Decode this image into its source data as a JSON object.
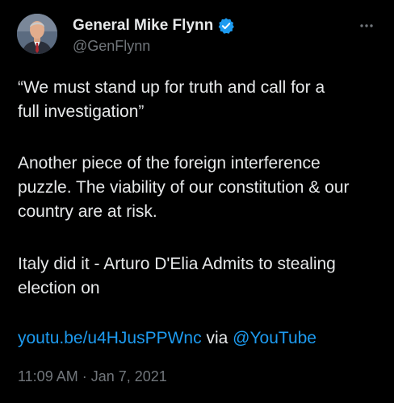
{
  "author": {
    "display_name": "General Mike Flynn",
    "handle": "@GenFlynn",
    "verified_icon": "verified-badge-icon",
    "avatar_icon": "profile-photo"
  },
  "more_icon": "more-options-icon",
  "tweet": {
    "paragraph_1": "“We must stand up for truth and call for a\nfull investigation”",
    "paragraph_2": "Another piece of the foreign interference\npuzzle. The viability of our constitution & our\ncountry are at risk.",
    "paragraph_3": "Italy did it -  Arturo D'Elia  Admits to stealing\nelection on",
    "link_url": "youtu.be/u4HJusPPWnc",
    "via_text": " via ",
    "mention": "@YouTube",
    "timestamp": "11:09 AM · Jan 7, 2021"
  },
  "colors": {
    "background": "#000000",
    "text": "#e7e9ea",
    "secondary": "#71767b",
    "link": "#1d9bf0"
  }
}
